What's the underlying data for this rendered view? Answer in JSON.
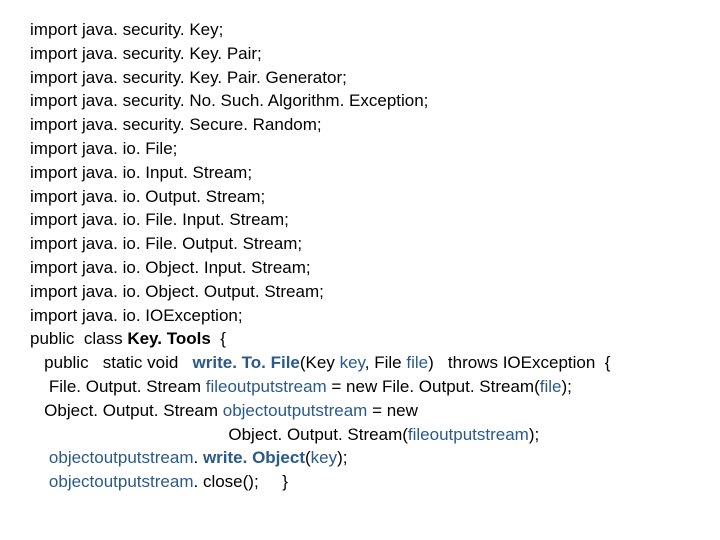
{
  "code": {
    "l1": "import java. security. Key;",
    "l2": "import java. security. Key. Pair;",
    "l3": "import java. security. Key. Pair. Generator;",
    "l4": "import java. security. No. Such. Algorithm. Exception;",
    "l5": "import java. security. Secure. Random;",
    "l6": "import java. io. File;",
    "l7": "import java. io. Input. Stream;",
    "l8": "import java. io. Output. Stream;",
    "l9": "import java. io. File. Input. Stream;",
    "l10": "import java. io. File. Output. Stream;",
    "l11": "import java. io. Object. Input. Stream;",
    "l12": "import java. io. Object. Output. Stream;",
    "l13": "import java. io. IOException;",
    "l14a": "public  class ",
    "l14b": "Key. Tools",
    "l14c": "  {",
    "l15a": "   public   static void   ",
    "l15b": "write. To. File",
    "l15c": "(Key ",
    "l15d": "key",
    "l15e": ", File ",
    "l15f": "file",
    "l15g": ")   throws IOException  {",
    "l16a": "    File. Output. Stream ",
    "l16b": "fileoutputstream",
    "l16c": " = new File. Output. Stream(",
    "l16d": "file",
    "l16e": ");",
    "l17a": "   Object. Output. Stream ",
    "l17b": "objectoutputstream",
    "l17c": " = new",
    "l18a": "                                          Object. Output. Stream(",
    "l18b": "fileoutputstream",
    "l18c": ");",
    "l19a": "    ",
    "l19b": "objectoutputstream",
    "l19c": ". ",
    "l19d": "write. Object",
    "l19e": "(",
    "l19f": "key",
    "l19g": ");",
    "l20a": "    ",
    "l20b": "objectoutputstream",
    "l20c": ". close();     }"
  }
}
